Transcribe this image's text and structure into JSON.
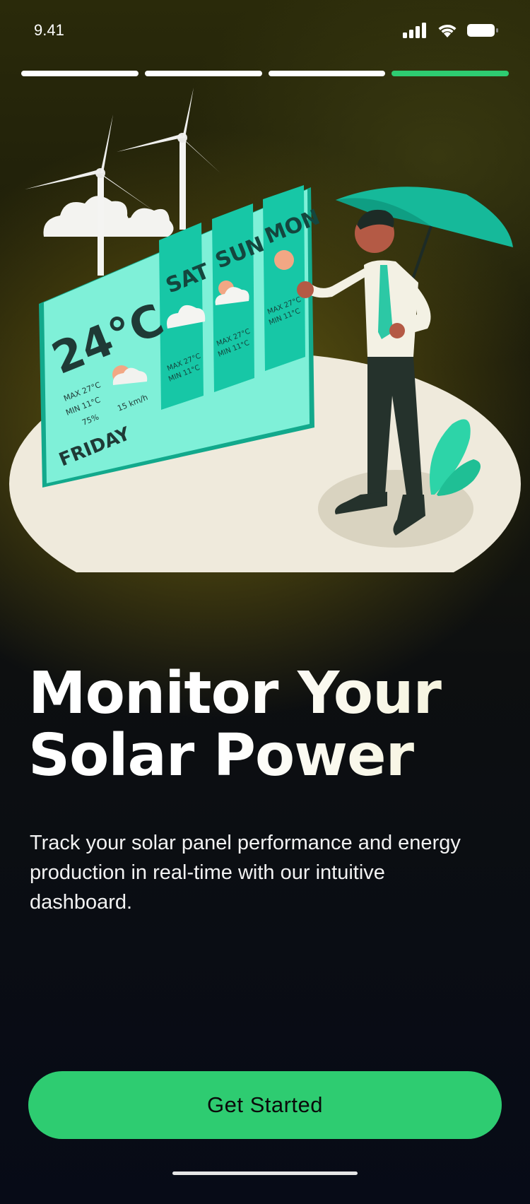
{
  "status_bar": {
    "time": "9.41"
  },
  "onboarding": {
    "progress_steps": [
      {
        "state": "complete"
      },
      {
        "state": "complete"
      },
      {
        "state": "complete"
      },
      {
        "state": "current"
      }
    ],
    "progress_value": "4/4"
  },
  "illustration": {
    "weather_card": {
      "temperature": "24°C",
      "max": "MAX 27°C",
      "min": "MIN 11°C",
      "humidity": "75%",
      "wind": "15 km/h",
      "day": "FRIDAY"
    },
    "forecast": [
      {
        "day": "SAT",
        "max": "MAX 27°C",
        "min": "MIN 11°C"
      },
      {
        "day": "SUN",
        "max": "MAX 27°C",
        "min": "MIN 11°C"
      },
      {
        "day": "MON",
        "max": "MAX 27°C",
        "min": "MIN 11°C"
      }
    ]
  },
  "content": {
    "title_line1": "Monitor Your",
    "title_line2": "Solar Power",
    "description": "Track your solar panel performance and energy production in real-time with our intuitive dashboard."
  },
  "actions": {
    "get_started_label": "Get Started"
  },
  "colors": {
    "accent": "#2ecc71",
    "panel": "#3fe0c0",
    "panel_dark": "#16bfa0"
  }
}
